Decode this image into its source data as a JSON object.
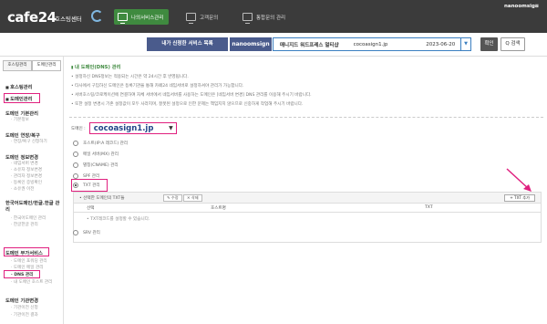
{
  "header": {
    "logo": "cafe24",
    "logo_sub": "호스팅센터",
    "nav": [
      "나의서비스관리",
      "고객문의",
      "통합문의 관리"
    ],
    "user": "nanoomsign",
    "user_caret": "▼"
  },
  "service_bar": {
    "label": "내가 신청한 서비스 목록",
    "user_id": "nanoomsign",
    "service_type": "매니지드 워드프레스 멀티샵",
    "domain": "cocoasign1.jp",
    "date": "2023-06-20",
    "dropdown_arrow": "▼",
    "confirm_label": "확인",
    "search_label": "Q 검색"
  },
  "sidebar": {
    "tabs": [
      "호스팅관리",
      "도메인관리"
    ],
    "sections": [
      {
        "title": "호스팅관리",
        "items": []
      },
      {
        "title": "도메인관리",
        "items": []
      },
      {
        "title": "도메인 기본관리",
        "items": [
          "기본정보"
        ]
      },
      {
        "title": "도메인 연장/복구",
        "items": [
          "연장/복구 신청하기"
        ]
      },
      {
        "title": "도메인 정보변경",
        "items": [
          "네임서버 변경",
          "소유자 정보변경",
          "관리자 정보변경",
          "등록인 증빙확인",
          "소유권 이전"
        ]
      },
      {
        "title": "한국어도메인/한글.한글 관리",
        "items": [
          "한국어도메인 관리",
          "한글한글 관리"
        ]
      },
      {
        "title": "도메인 부가서비스",
        "items": [
          "도메인 포워딩 관리",
          "도메인 메일 관리",
          "DNS 관리",
          "내 도메인 호스트 관리"
        ]
      },
      {
        "title": "도메인 기관변경",
        "items": [
          "기관이전 신청",
          "기관이전 결과"
        ]
      }
    ]
  },
  "main": {
    "title": "내 도메인(DNS) 관리",
    "notes": [
      "설정하신 DNS정보는 적용되는 시간은 약 24시간 후 반영됩니다.",
      "타사에서 구입하신 도메인은 등록기관을 통해 카페24 네임서버로 설정하셔야 관리가 가능합니다.",
      "서버호스팅/코로케이션에 연결하여 자체 서버에서 네임서버를 사용하는 도메인은 [네임서버 변경] DNS 관리를 이용해 주시기 바랍니다.",
      "또한 설정 변경시 기존 설정값이 모두 사라지며, 잘못된 설정으로 인한 문제는 책임지지 않으므로 신중하게 작업해 주시기 바랍니다."
    ],
    "domain_label": "도메인 :",
    "domain_value": "cocoasign1.jp",
    "domain_caret": "▼",
    "records": [
      {
        "label": "호스트(IP:A 레코드) 관리",
        "selected": false
      },
      {
        "label": "메일 서버(MX) 관리",
        "selected": false
      },
      {
        "label": "별칭(CNAME) 관리",
        "selected": false
      },
      {
        "label": "SPF 관리",
        "selected": false
      },
      {
        "label": "TXT 관리",
        "selected": true
      },
      {
        "label": "SRV 관리",
        "selected": false
      }
    ],
    "txt_panel": {
      "title": "선택한 도메인의 TXT들",
      "edit_label": "수정",
      "delete_label": "삭제",
      "add_label": "TXT 추가",
      "columns": [
        "선택",
        "호스트명",
        "TXT"
      ],
      "empty_text": "TXT레코드를 설정할 수 있습니다."
    }
  },
  "colors": {
    "header_bg": "#3b3b3b",
    "nav_active": "#3f8a3f",
    "service_bar_label": "#4a5b8c",
    "highlight": "#e0207f"
  }
}
